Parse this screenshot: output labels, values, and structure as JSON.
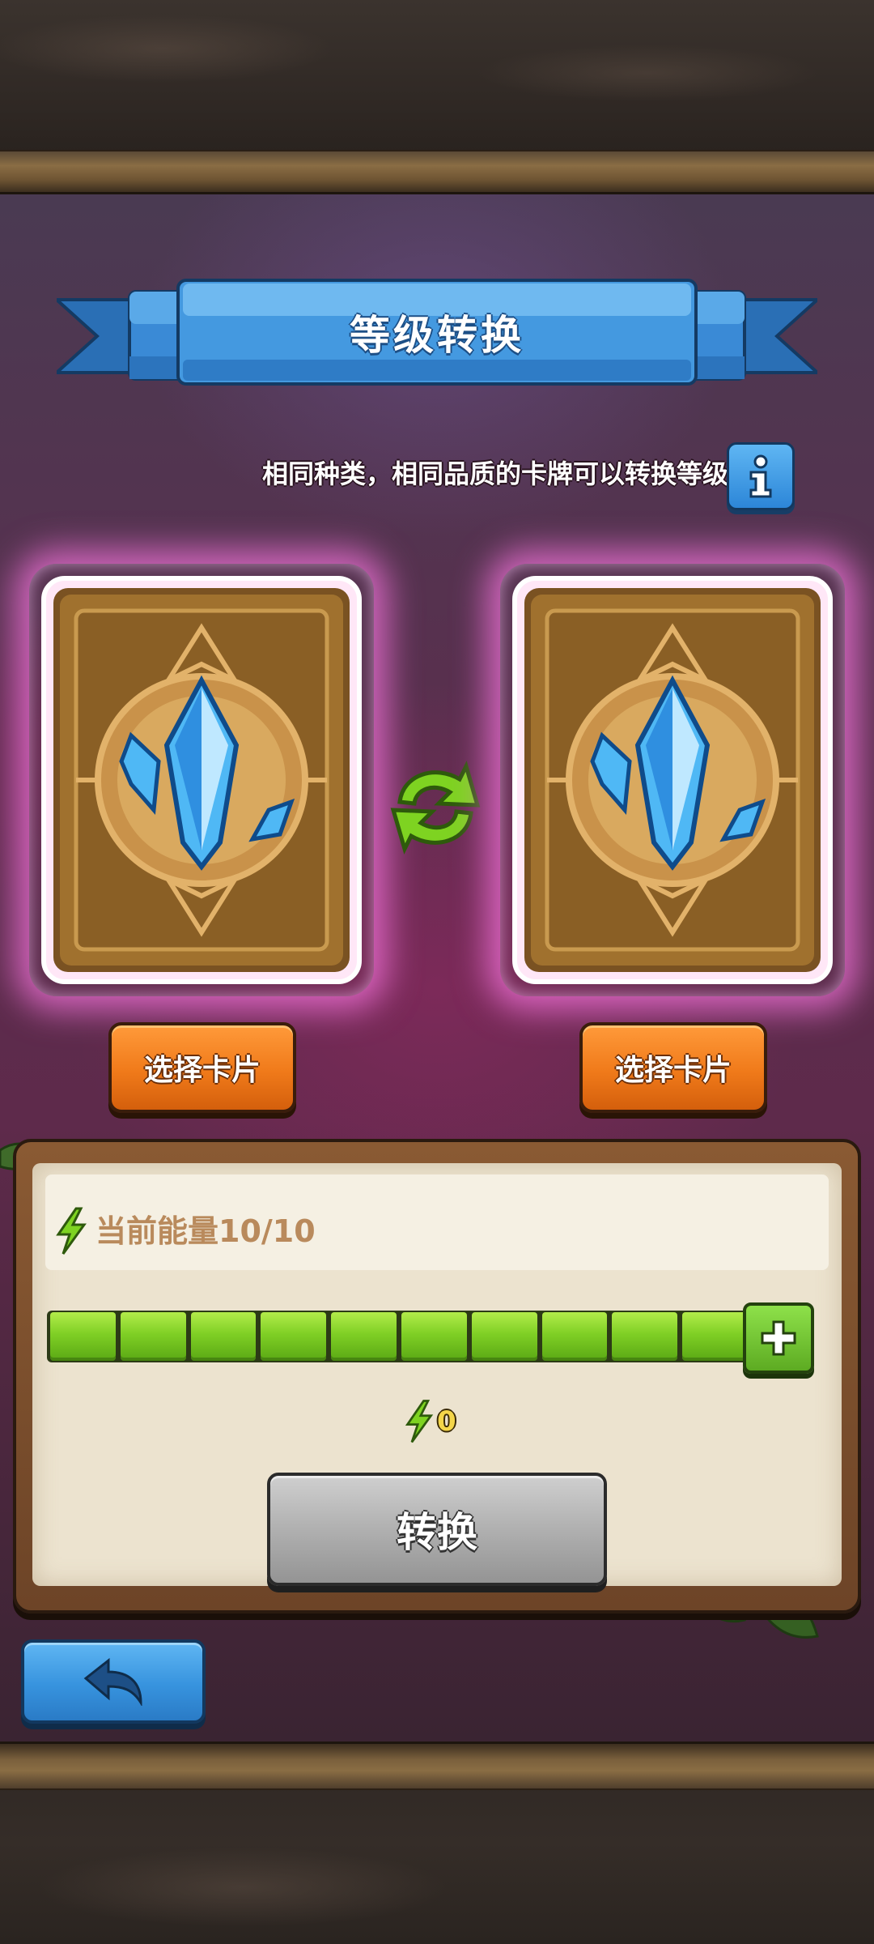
{
  "header": {
    "title": "等级转换",
    "hint": "相同种类，相同品质的卡牌可以转换等级"
  },
  "cards": {
    "left_button": "选择卡片",
    "right_button": "选择卡片"
  },
  "energy": {
    "label": "当前能量10/10",
    "current": 10,
    "max": 10,
    "segments_filled": 10
  },
  "cost": {
    "value": "0"
  },
  "actions": {
    "convert_label": "转换"
  },
  "icons": {
    "info": "info-icon",
    "swap": "swap-arrows-icon",
    "energy": "lightning-icon",
    "plus": "plus-icon",
    "back": "back-arrow-icon",
    "gem": "crystal-gem-icon"
  },
  "colors": {
    "banner_blue": "#3a8ad6",
    "orange_button": "#f07a1a",
    "energy_green": "#7fcf25",
    "convert_disabled": "#b0b0b0",
    "back_blue": "#3793de",
    "card_glow": "#ff78e6"
  }
}
